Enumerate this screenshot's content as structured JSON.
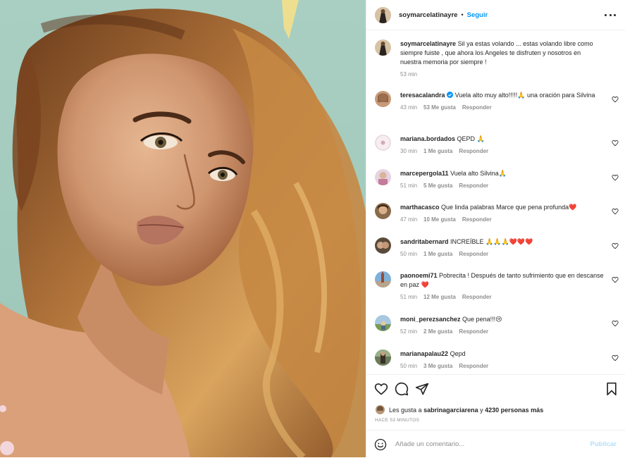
{
  "post": {
    "author": "soymarcelatinayre",
    "separator": "•",
    "follow_label": "Seguir",
    "more_icon": "more-options-icon"
  },
  "caption": {
    "username": "soymarcelatinayre",
    "text": "Sil ya estas volando ... estas volando libre como siempre fuiste , que ahora los Angeles te disfruten y nosotros en nuestra memoria por siempre !",
    "time": "53 min"
  },
  "comments": [
    {
      "username": "teresacalandra",
      "verified": true,
      "text": "Vuela alto muy alto!!!!!🙏 una oración para Silvina",
      "time": "43 min",
      "likes": "53 Me gusta",
      "reply": "Responder"
    },
    {
      "username": "mariana.bordados",
      "verified": false,
      "text": "QEPD 🙏",
      "time": "30 min",
      "likes": "1 Me gusta",
      "reply": "Responder"
    },
    {
      "username": "marcepergola11",
      "verified": false,
      "text": "Vuela alto Silvina🙏",
      "time": "51 min",
      "likes": "5 Me gusta",
      "reply": "Responder"
    },
    {
      "username": "marthacasco",
      "verified": false,
      "text": "Que linda palabras Marce que pena profunda❤️",
      "time": "47 min",
      "likes": "10 Me gusta",
      "reply": "Responder"
    },
    {
      "username": "sandritabernard",
      "verified": false,
      "text": "INCREÍBLE 🙏🙏🙏❤️❤️❤️",
      "time": "50 min",
      "likes": "1 Me gusta",
      "reply": "Responder"
    },
    {
      "username": "paonoemi71",
      "verified": false,
      "text": "Pobrecita ! Después de tanto sufrimiento que en descanse en paz ❤️",
      "time": "51 min",
      "likes": "12 Me gusta",
      "reply": "Responder"
    },
    {
      "username": "moni_perezsanchez",
      "verified": false,
      "text": "Que pena!!!😢",
      "time": "52 min",
      "likes": "2 Me gusta",
      "reply": "Responder"
    },
    {
      "username": "marianapalau22",
      "verified": false,
      "text": "Qepd",
      "time": "50 min",
      "likes": "3 Me gusta",
      "reply": "Responder"
    }
  ],
  "likes_summary": {
    "prefix": "Les gusta a",
    "user": "sabrinagarciarena",
    "middle": "y",
    "others": "4230 personas más"
  },
  "timestamp": "HACE 53 MINUTOS",
  "composer": {
    "placeholder": "Añade un comentario...",
    "publish_label": "Publicar"
  },
  "colors": {
    "accent": "#0095f6",
    "publish_disabled": "#b2dffc",
    "photo_background": "#a7ccbf",
    "heart": "#ed4956"
  }
}
